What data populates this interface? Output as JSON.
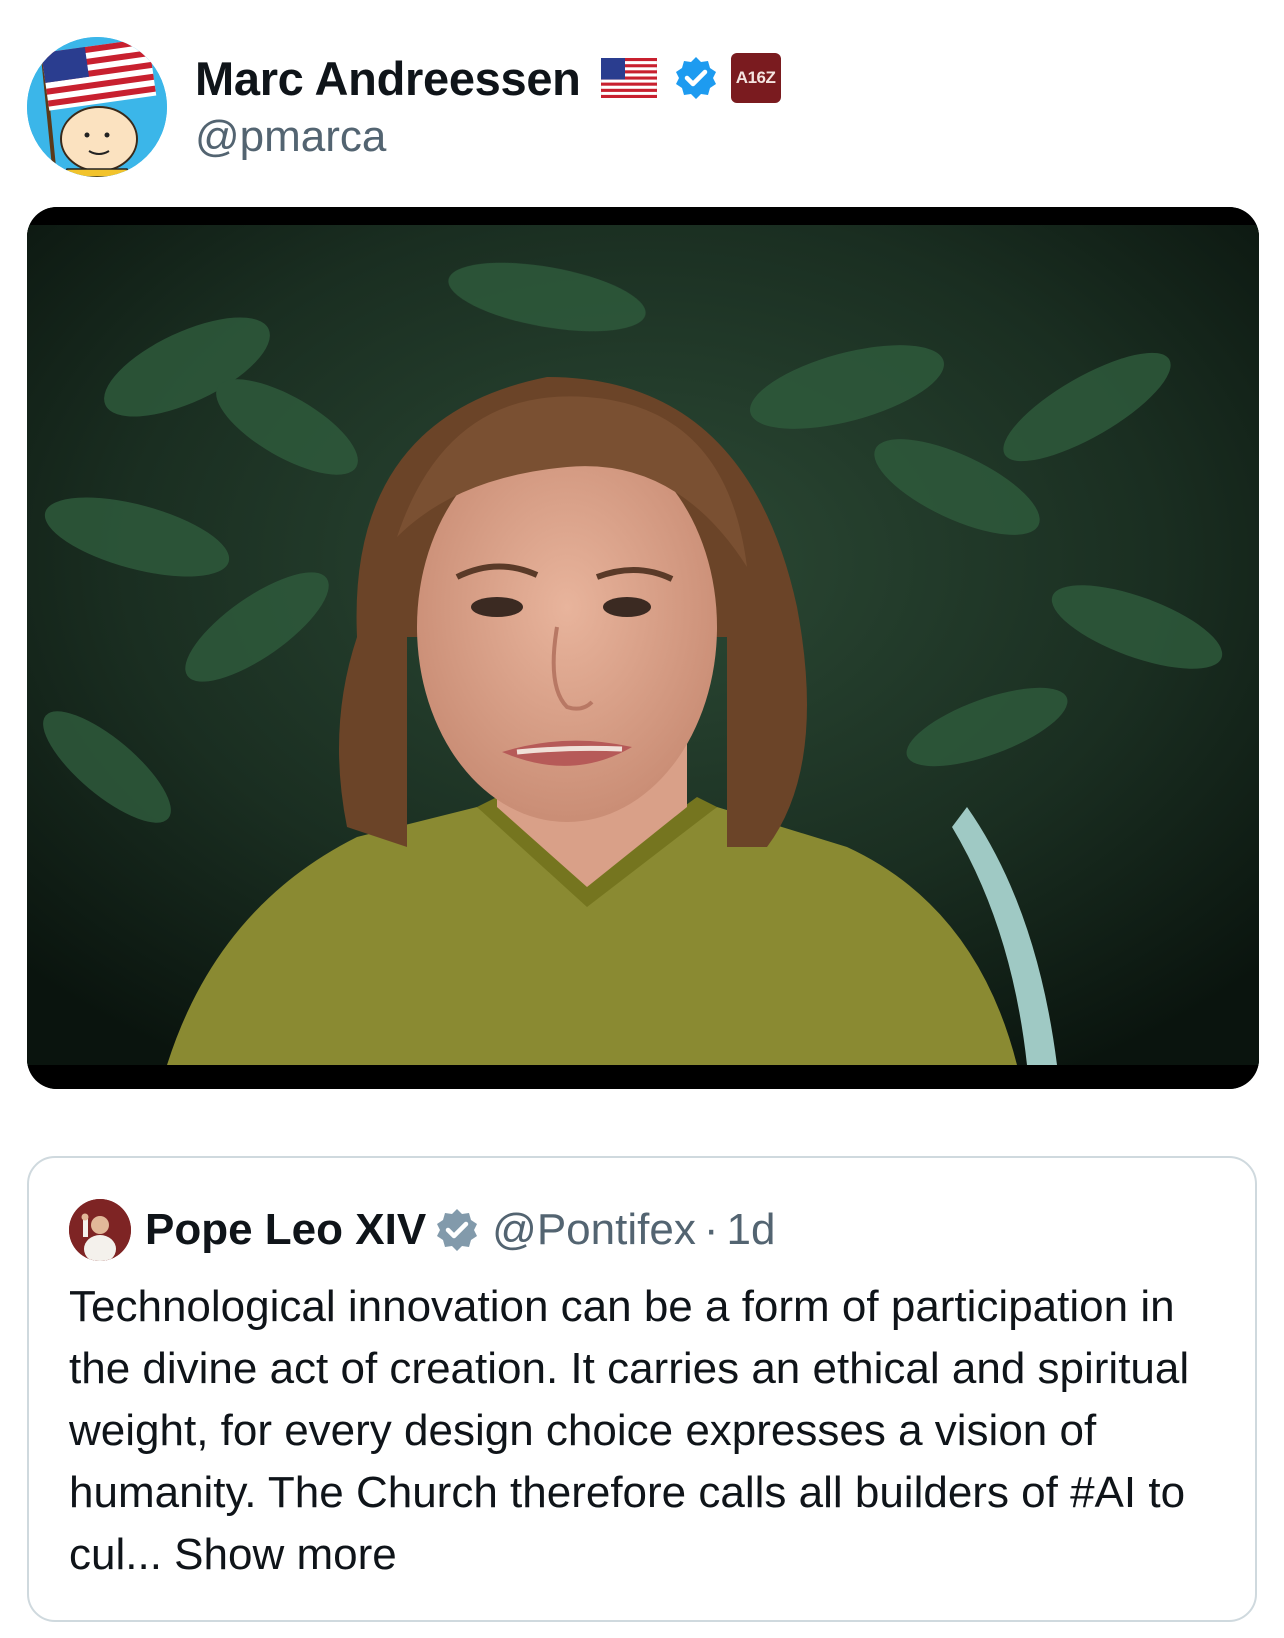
{
  "author": {
    "display_name": "Marc Andreessen",
    "handle": "@pmarca",
    "avatar_icon": "cartoon-flag-avatar-icon",
    "flag_icon": "us-flag-icon",
    "verified_icon": "verified-badge-icon",
    "org_badge": {
      "label": "A16Z",
      "color": "#7a1b1f"
    },
    "verified_color": "#1d9bf0"
  },
  "media": {
    "type": "video-frame",
    "icon": "video-still-icon"
  },
  "quote": {
    "display_name": "Pope Leo XIV",
    "handle": "@Pontifex",
    "separator": "·",
    "time": "1d",
    "verified_icon": "verified-badge-icon",
    "verified_color": "#829aab",
    "text": "Technological innovation can be a form of participation in the divine act of creation. It carries an ethical and spiritual weight, for every design choice expresses a vision of humanity. The Church therefore calls all builders of #AI to cul...",
    "show_more": "Show more"
  },
  "colors": {
    "text_primary": "#0f1419",
    "text_secondary": "#536471",
    "border": "#cfd9de"
  }
}
